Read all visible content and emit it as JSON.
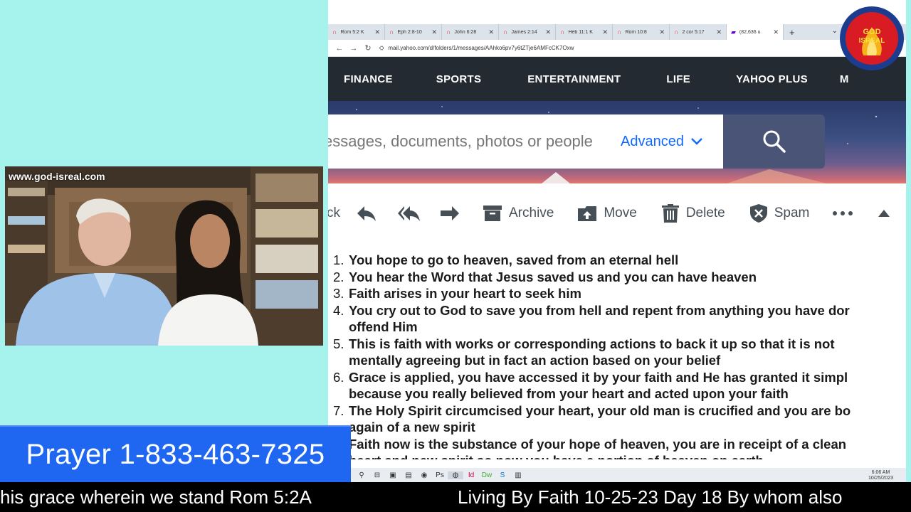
{
  "browser": {
    "tabs": [
      {
        "label": "Rom 5:2 K",
        "active": false
      },
      {
        "label": "Eph 2:8-10",
        "active": false
      },
      {
        "label": "John 6:28",
        "active": false
      },
      {
        "label": "James 2:14",
        "active": false
      },
      {
        "label": "Heb 11:1 K",
        "active": false
      },
      {
        "label": "Rom 10:8",
        "active": false
      },
      {
        "label": "2 cor 5:17",
        "active": false
      },
      {
        "label": "(82,636 u",
        "active": true
      }
    ],
    "url": "mail.yahoo.com/d/folders/1/messages/AAhko6pv7y6tZTje6AMFcCK7Oxw"
  },
  "yahoo": {
    "nav": [
      "FINANCE",
      "SPORTS",
      "ENTERTAINMENT",
      "LIFE",
      "YAHOO PLUS",
      "M"
    ],
    "search_placeholder": "essages, documents, photos or people",
    "advanced_label": "Advanced",
    "toolbar": {
      "back_fragment": "ck",
      "archive": "Archive",
      "move": "Move",
      "delete": "Delete",
      "spam": "Spam"
    }
  },
  "message_items": [
    {
      "num": "1.",
      "lines": [
        "You hope to go to heaven, saved from an eternal hell"
      ]
    },
    {
      "num": "2.",
      "lines": [
        "You hear the Word that Jesus saved us and you can have heaven"
      ]
    },
    {
      "num": "3.",
      "lines": [
        "Faith arises in your heart to seek him"
      ]
    },
    {
      "num": "4.",
      "lines": [
        "You cry out to God to save you from hell and repent from anything you have dor",
        "offend Him"
      ]
    },
    {
      "num": "5.",
      "lines": [
        "This is faith with works or corresponding actions to back it up so that it is not",
        "mentally agreeing but in fact an action based on your belief"
      ]
    },
    {
      "num": "6.",
      "lines": [
        "Grace is applied, you have accessed it by your faith and He has granted it simpl",
        "because you really believed from your heart and acted upon your faith"
      ]
    },
    {
      "num": "7.",
      "lines": [
        "The Holy Spirit circumcised your heart, your old man is crucified and you are bo",
        "again of a new spirit"
      ]
    },
    {
      "num": "",
      "lines": [
        "Faith now is the substance of your hope of heaven, you are in receipt of a clean",
        "heart and new spirit so now you have a portion of heaven on earth"
      ]
    }
  ],
  "taskbar": {
    "time": "6:06 AM",
    "date": "10/25/2023"
  },
  "webcam": {
    "url_label": "www.god-isreal.com"
  },
  "logo": {
    "text_top": "GOD",
    "text_bottom": "ISREAL"
  },
  "prayer_banner": "Prayer 1-833-463-7325",
  "ticker": {
    "left": "his grace wherein we stand Rom 5:2A",
    "right": "Living By Faith 10-25-23 Day 18 By whom also"
  },
  "colors": {
    "background": "#a6f3ee",
    "prayer_bg": "#1f67f1",
    "yahoo_nav": "#232a31",
    "advanced": "#0f69ff",
    "ticker_bg": "#000000"
  }
}
